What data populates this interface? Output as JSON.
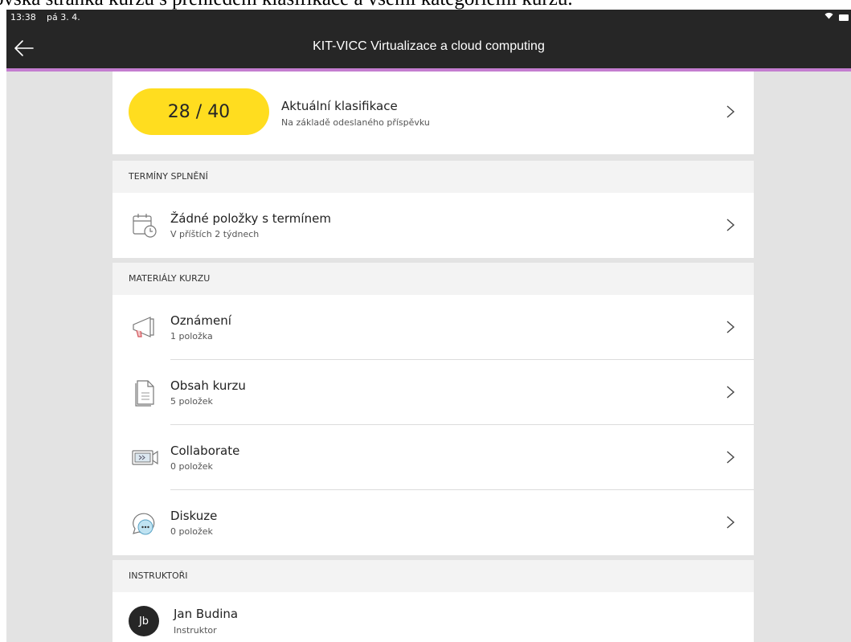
{
  "caption": "ovská stránka kurzu s přehledem klasifikace a všemi kategoriemi kurzu.",
  "status_bar": {
    "time": "13:38",
    "date": "pá 3. 4."
  },
  "nav": {
    "title": "KIT-VICC Virtualizace a cloud computing",
    "back_icon": "arrow-left-icon"
  },
  "colors": {
    "accent": "#c47dd0",
    "grade_pill": "#ffdd1f",
    "nav_bg": "#262626",
    "page_bg": "#e3e3e3"
  },
  "grade": {
    "value": "28 / 40",
    "title": "Aktuální klasifikace",
    "subtitle": "Na základě odeslaného příspěvku"
  },
  "deadlines": {
    "header": "TERMÍNY SPLNĚNÍ",
    "item": {
      "title": "Žádné položky s termínem",
      "subtitle": "V příštích 2 týdnech",
      "icon": "calendar-clock-icon"
    }
  },
  "materials": {
    "header": "MATERIÁLY KURZU",
    "items": [
      {
        "title": "Oznámení",
        "subtitle": "1 položka",
        "icon": "megaphone-icon"
      },
      {
        "title": "Obsah kurzu",
        "subtitle": "5 položek",
        "icon": "document-icon"
      },
      {
        "title": "Collaborate",
        "subtitle": "0 položek",
        "icon": "video-camera-icon"
      },
      {
        "title": "Diskuze",
        "subtitle": "0 položek",
        "icon": "chat-bubble-icon"
      }
    ]
  },
  "instructors": {
    "header": "INSTRUKTOŘI",
    "items": [
      {
        "initials": "Jb",
        "name": "Jan Budina",
        "role": "Instruktor"
      }
    ]
  }
}
